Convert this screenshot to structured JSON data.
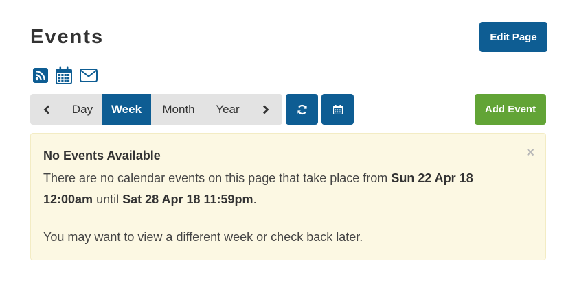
{
  "page": {
    "title": "Events",
    "edit_label": "Edit Page"
  },
  "feed_icons": [
    "rss-icon",
    "calendar-icon",
    "envelope-icon"
  ],
  "view_controls": {
    "prev_icon": "chevron-left-icon",
    "next_icon": "chevron-right-icon",
    "views": [
      {
        "label": "Day",
        "active": false
      },
      {
        "label": "Week",
        "active": true
      },
      {
        "label": "Month",
        "active": false
      },
      {
        "label": "Year",
        "active": false
      }
    ],
    "refresh_icon": "refresh-icon",
    "calendar_icon": "calendar-icon",
    "add_event_label": "Add Event"
  },
  "alert": {
    "title": "No Events Available",
    "body_prefix": "There are no calendar events on this page that take place from",
    "start": "Sun 22 Apr 18 12:00am",
    "until": "until",
    "end": "Sat 28 Apr 18 11:59pm",
    "end_punct": ".",
    "later": "You may want to view a different week or check back later.",
    "close_symbol": "×"
  },
  "colors": {
    "primary": "#0e5d93",
    "success": "#62a436",
    "segment_bg": "#e3e3e3",
    "alert_bg": "#fcf8e3",
    "alert_border": "#f3ecc4"
  }
}
